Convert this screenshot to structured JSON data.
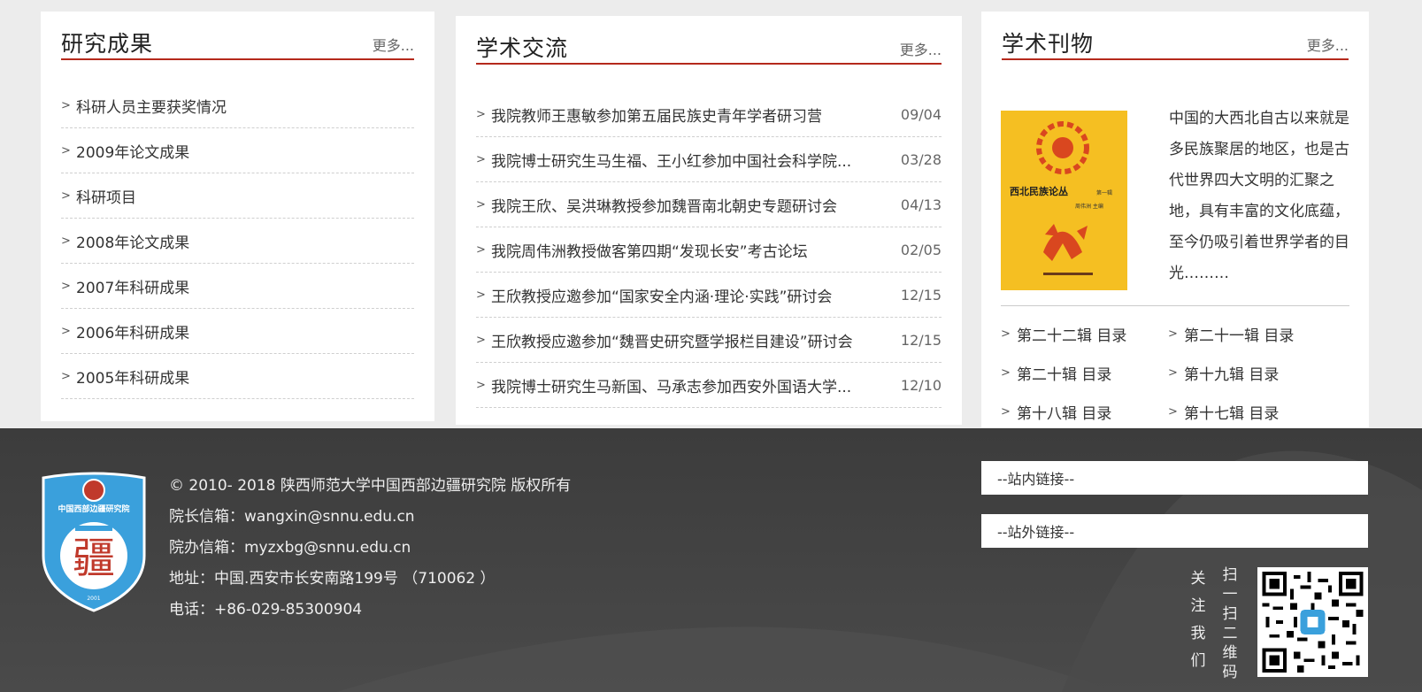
{
  "research": {
    "title": "研究成果",
    "more": "更多...",
    "items": [
      "科研人员主要获奖情况",
      "2009年论文成果",
      "科研项目",
      "2008年论文成果",
      "2007年科研成果",
      "2006年科研成果",
      "2005年科研成果"
    ]
  },
  "exchange": {
    "title": "学术交流",
    "more": "更多...",
    "items": [
      {
        "text": "我院教师王惠敏参加第五届民族史青年学者研习营",
        "date": "09/04"
      },
      {
        "text": "我院博士研究生马生福、王小红参加中国社会科学院...",
        "date": "03/28"
      },
      {
        "text": "我院王欣、吴洪琳教授参加魏晋南北朝史专题研讨会",
        "date": "04/13"
      },
      {
        "text": "我院周伟洲教授做客第四期“发现长安”考古论坛",
        "date": "02/05"
      },
      {
        "text": "王欣教授应邀参加“国家安全内涵·理论·实践”研讨会",
        "date": "12/15"
      },
      {
        "text": "王欣教授应邀参加“魏晋史研究暨学报栏目建设”研讨会",
        "date": "12/15"
      },
      {
        "text": "我院博士研究生马新国、马承志参加西安外国语大学...",
        "date": "12/10"
      }
    ]
  },
  "journal": {
    "title": "学术刊物",
    "more": "更多...",
    "book_title": "西北民族论丛",
    "book_issue": "第一辑",
    "book_editor": "周伟洲 主编",
    "description": "中国的大西北自古以来就是多民族聚居的地区，也是古代世界四大文明的汇聚之地，具有丰富的文化底蕴，至今仍吸引着世界学者的目光………",
    "issues": [
      "第二十二辑 目录",
      "第二十一辑 目录",
      "第二十辑 目录",
      "第十九辑 目录",
      "第十八辑 目录",
      "第十七辑 目录"
    ]
  },
  "footer": {
    "copyright": "© 2010- 2018 陕西师范大学中国西部边疆研究院 版权所有",
    "director_email": "院长信箱：wangxin@snnu.edu.cn",
    "office_email": "院办信箱：myzxbg@snnu.edu.cn",
    "address": "地址：中国.西安市长安南路199号 （710062 ）",
    "phone": "电话：+86-029-85300904",
    "internal_links": "--站内链接--",
    "external_links": "--站外链接--",
    "follow_chars": [
      "关",
      "注",
      "我",
      "们"
    ],
    "scan_chars": [
      "扫",
      "一",
      "扫",
      "二",
      "维",
      "码"
    ],
    "logo_text": "中国西部边疆研究院",
    "logo_char": "疆",
    "logo_year": "2001"
  },
  "colors": {
    "accent": "#b5291c",
    "footer_bg": "#3d3d3d",
    "logo_blue": "#3aa0dc"
  }
}
